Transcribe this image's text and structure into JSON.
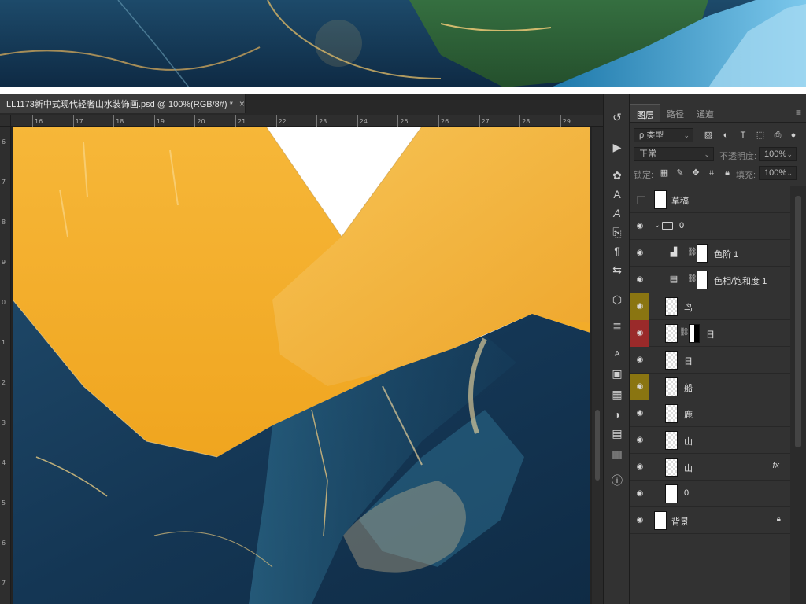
{
  "document": {
    "tab_title": "LL1173新中式现代轻奢山水装饰画.psd @ 100%(RGB/8#) *",
    "close_glyph": "×"
  },
  "ruler": {
    "top_ticks": [
      "16",
      "17",
      "18",
      "19",
      "20",
      "21",
      "22",
      "23",
      "24",
      "25",
      "26",
      "27",
      "28",
      "29"
    ],
    "left_ticks": [
      "6",
      "7",
      "8",
      "9",
      "0",
      "1",
      "2",
      "3",
      "4",
      "5",
      "6",
      "7"
    ]
  },
  "tools": [
    "history-brush-icon",
    "play-icon",
    "palette-icon",
    "text-a-icon",
    "text-italic-icon",
    "clone-stamp-icon",
    "paragraph-icon",
    "adjust-icon",
    "cube-icon",
    "list-icon",
    "text-style-icon",
    "image-frame-icon",
    "grid-icon",
    "circle-half-icon",
    "document-icon",
    "notes-icon",
    "info-icon"
  ],
  "panel": {
    "tabs": [
      "图层",
      "路径",
      "通道"
    ],
    "active_tab": "图层",
    "filter_label": "ρ 类型",
    "blend_mode": "正常",
    "opacity_label": "不透明度:",
    "opacity_value": "100%",
    "lock_label": "锁定:",
    "fill_label": "填充:",
    "fill_value": "100%"
  },
  "layers": [
    {
      "name": "草稿",
      "visible": false,
      "highlight": "none"
    },
    {
      "name": "0",
      "visible": true,
      "highlight": "none",
      "group": true
    },
    {
      "name": "色阶 1",
      "visible": true,
      "highlight": "none",
      "adjustment": "levels"
    },
    {
      "name": "色相/饱和度 1",
      "visible": true,
      "highlight": "none",
      "adjustment": "hue-saturation"
    },
    {
      "name": "鸟",
      "visible": true,
      "highlight": "yellow"
    },
    {
      "name": "日",
      "visible": true,
      "highlight": "red",
      "mask": true
    },
    {
      "name": "日",
      "visible": true,
      "highlight": "none"
    },
    {
      "name": "船",
      "visible": true,
      "highlight": "yellow"
    },
    {
      "name": "鹿",
      "visible": true,
      "highlight": "none"
    },
    {
      "name": "山",
      "visible": true,
      "highlight": "none"
    },
    {
      "name": "山",
      "visible": true,
      "highlight": "none",
      "fx": "fx"
    },
    {
      "name": "0",
      "visible": true,
      "highlight": "none"
    },
    {
      "name": "背景",
      "visible": true,
      "highlight": "none",
      "locked": true
    }
  ],
  "colors": {
    "yellow_highlight": "#8a7511",
    "red_highlight": "#9a2a2a",
    "gold": "#f3b23a",
    "navy": "#153a57"
  }
}
